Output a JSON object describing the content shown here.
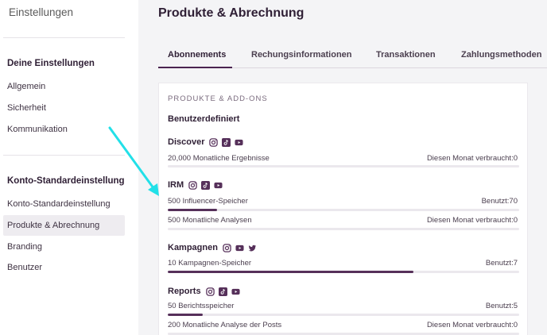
{
  "sidebar": {
    "title": "Einstellungen",
    "section1": {
      "heading": "Deine Einstellungen",
      "items": [
        {
          "label": "Allgemein"
        },
        {
          "label": "Sicherheit"
        },
        {
          "label": "Kommunikation"
        }
      ]
    },
    "section2": {
      "heading": "Konto-Standardeinstellung",
      "items": [
        {
          "label": "Konto-Standardeinstellung"
        },
        {
          "label": "Produkte & Abrechnung",
          "active": true
        },
        {
          "label": "Branding"
        },
        {
          "label": "Benutzer"
        }
      ]
    }
  },
  "main": {
    "title": "Produkte & Abrechnung",
    "tabs": [
      {
        "label": "Abonnements",
        "active": true
      },
      {
        "label": "Rechungsinformationen"
      },
      {
        "label": "Transaktionen"
      },
      {
        "label": "Zahlungsmethoden"
      }
    ],
    "card": {
      "subtitle": "PRODUKTE & ADD-ONS",
      "heading": "Benutzerdefiniert",
      "products": [
        {
          "name": "Discover",
          "icons": [
            "instagram-icon",
            "tiktok-icon",
            "youtube-icon"
          ],
          "rows": [
            {
              "label": "20,000 Monatliche Ergebnisse",
              "status": "Diesen Monat verbraucht:0",
              "progress": 0
            }
          ]
        },
        {
          "name": "IRM",
          "icons": [
            "instagram-icon",
            "tiktok-icon",
            "youtube-icon"
          ],
          "rows": [
            {
              "label": "500 Influencer-Speicher",
              "status": "Benutzt:70",
              "progress": 0.14
            },
            {
              "label": "500 Monatliche Analysen",
              "status": "Diesen Monat verbraucht:0",
              "progress": 0
            }
          ]
        },
        {
          "name": "Kampagnen",
          "icons": [
            "instagram-icon",
            "youtube-icon",
            "twitter-icon"
          ],
          "rows": [
            {
              "label": "10 Kampagnen-Speicher",
              "status": "Benutzt:7",
              "progress": 0.7
            }
          ]
        },
        {
          "name": "Reports",
          "icons": [
            "instagram-icon",
            "tiktok-icon",
            "youtube-icon"
          ],
          "rows": [
            {
              "label": "50 Berichtsspeicher",
              "status": "Benutzt:5",
              "progress": 0.1
            },
            {
              "label": "200 Monatliche Analyse der Posts",
              "status": "Diesen Monat verbraucht:0",
              "progress": 0
            }
          ]
        }
      ]
    }
  },
  "annotation": {
    "arrow_color": "#22e0e8"
  },
  "colors": {
    "accent": "#56305a",
    "track": "#ebe8ed"
  }
}
